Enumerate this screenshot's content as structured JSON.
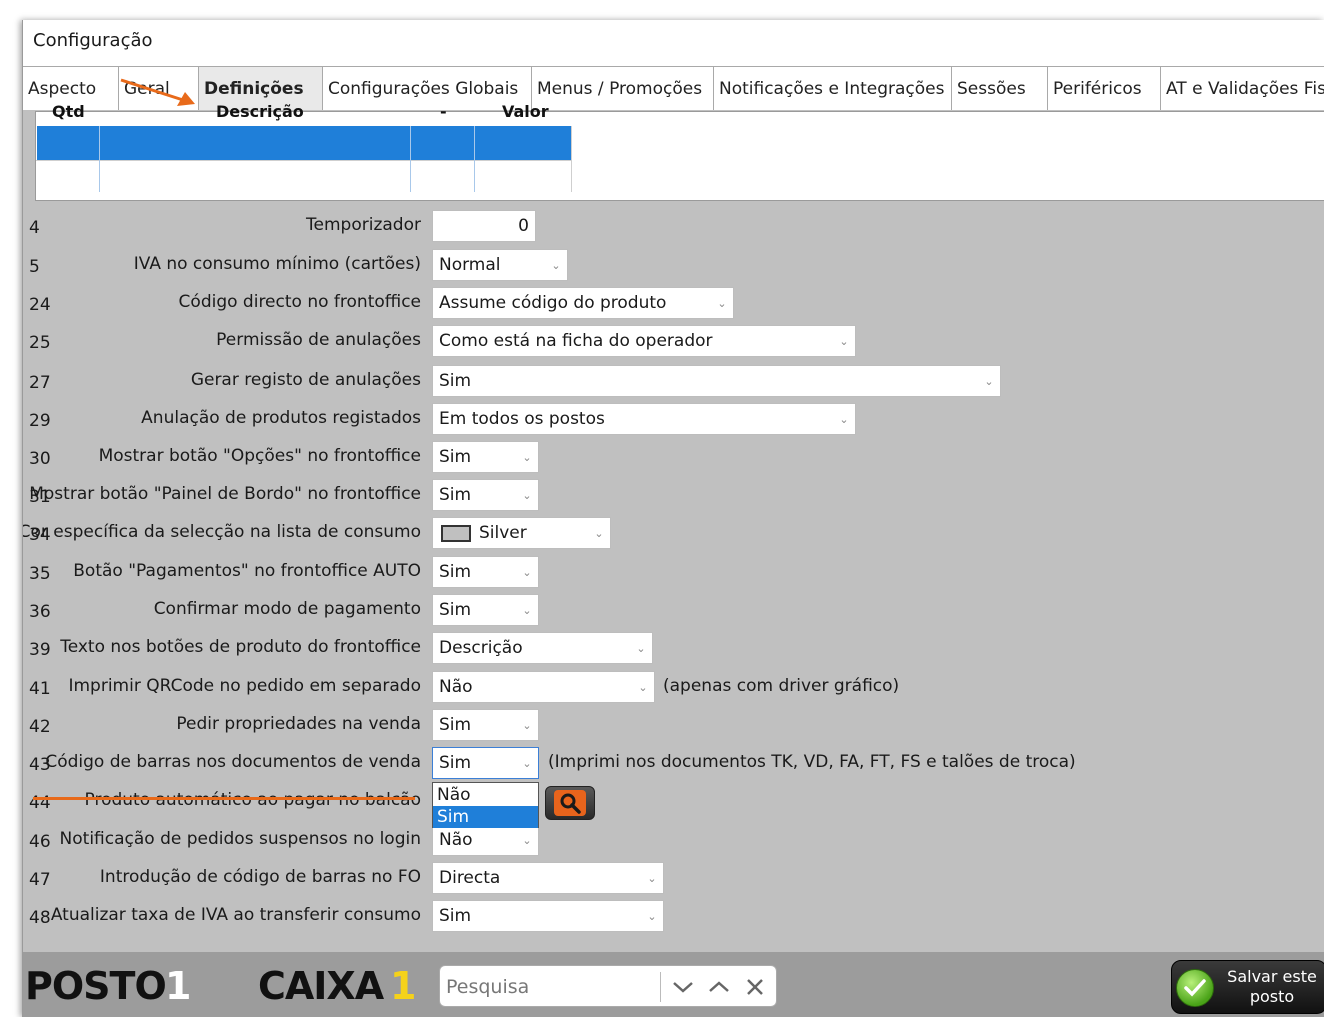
{
  "window": {
    "title": "Configuração"
  },
  "tabs": [
    {
      "label": "Aspecto"
    },
    {
      "label": "Geral"
    },
    {
      "label": "Definições"
    },
    {
      "label": "Configurações Globais"
    },
    {
      "label": "Menus / Promoções"
    },
    {
      "label": "Notificações e Integrações"
    },
    {
      "label": "Sessões"
    },
    {
      "label": "Periféricos"
    },
    {
      "label": "AT e Validações Fisca"
    }
  ],
  "grid": {
    "headers": [
      "Qtd",
      "Descrição",
      "-",
      "Valor"
    ]
  },
  "rows": [
    {
      "num": "4",
      "label": "Temporizador",
      "value": "0"
    },
    {
      "num": "5",
      "label": "IVA no consumo mínimo (cartões)",
      "value": "Normal"
    },
    {
      "num": "24",
      "label": "Código directo no frontoffice",
      "value": "Assume código do produto"
    },
    {
      "num": "25",
      "label": "Permissão de anulações",
      "value": "Como está na ficha do operador"
    },
    {
      "num": "27",
      "label": "Gerar registo de anulações",
      "value": "Sim"
    },
    {
      "num": "29",
      "label": "Anulação de produtos registados",
      "value": "Em todos os postos"
    },
    {
      "num": "30",
      "label": "Mostrar botão \"Opções\" no frontoffice",
      "value": "Sim"
    },
    {
      "num": "31",
      "label": "Mostrar botão \"Painel de Bordo\" no frontoffice",
      "value": "Sim"
    },
    {
      "num": "34",
      "label": "Cor específica da selecção na lista de consumo",
      "value": "Silver",
      "swatch": "#c0c0c0"
    },
    {
      "num": "35",
      "label": "Botão \"Pagamentos\" no frontoffice AUTO",
      "value": "Sim"
    },
    {
      "num": "36",
      "label": "Confirmar modo de pagamento",
      "value": "Sim"
    },
    {
      "num": "39",
      "label": "Texto nos botões de produto do frontoffice",
      "value": "Descrição"
    },
    {
      "num": "41",
      "label": "Imprimir QRCode no pedido em separado",
      "value": "Não",
      "note": "(apenas com driver gráfico)"
    },
    {
      "num": "42",
      "label": "Pedir propriedades na venda",
      "value": "Sim"
    },
    {
      "num": "43",
      "label": "Código de barras nos documentos de venda",
      "value": "Sim",
      "note": "(Imprimi nos documentos TK, VD, FA, FT, FS e talões de troca)"
    },
    {
      "num": "44",
      "label": "Produto automático ao pagar no balcão",
      "value": ""
    },
    {
      "num": "46",
      "label": "Notificação de pedidos suspensos no login",
      "value": "Não"
    },
    {
      "num": "47",
      "label": "Introdução de código de barras no FO",
      "value": "Directa"
    },
    {
      "num": "48",
      "label": "Atualizar taxa de IVA ao transferir consumo",
      "value": "Sim"
    }
  ],
  "dropdown_options": [
    "Não",
    "Sim"
  ],
  "footer": {
    "posto_label": "POSTO",
    "posto_num": "1",
    "caixa_label": "CAIXA",
    "caixa_num": "1",
    "search_placeholder": "Pesquisa",
    "save_label": "Salvar este posto"
  },
  "colors": {
    "accent_orange": "#e86a1a",
    "selection_blue": "#1f7fd9",
    "caixa_num": "#f5d21a"
  }
}
